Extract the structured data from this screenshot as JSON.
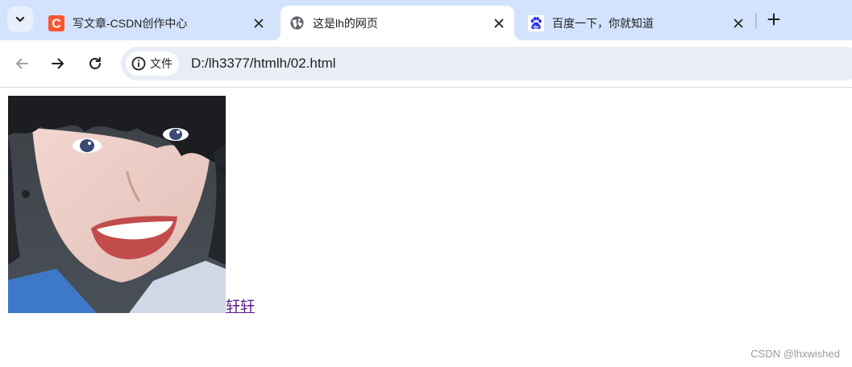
{
  "tabs": [
    {
      "title": "写文章-CSDN创作中心",
      "favicon": "csdn-icon",
      "active": false
    },
    {
      "title": "这是lh的网页",
      "favicon": "globe-icon",
      "active": true
    },
    {
      "title": "百度一下，你就知道",
      "favicon": "baidu-paw-icon",
      "active": false
    }
  ],
  "toolbar": {
    "back_icon": "arrow-left-icon",
    "forward_icon": "arrow-right-icon",
    "reload_icon": "reload-icon",
    "security_label": "文件",
    "url": "D:/lh3377/htmlh/02.html"
  },
  "page": {
    "image_icon": "portrait-photo",
    "link_text": "轩轩"
  },
  "watermark": "CSDN @lhxwished",
  "colors": {
    "tabstrip_bg": "#d3e3fd",
    "omnibox_bg": "#e9eef6",
    "csdn_red": "#fc5531",
    "baidu_blue": "#2932e1",
    "visited_link": "#551a8b"
  }
}
